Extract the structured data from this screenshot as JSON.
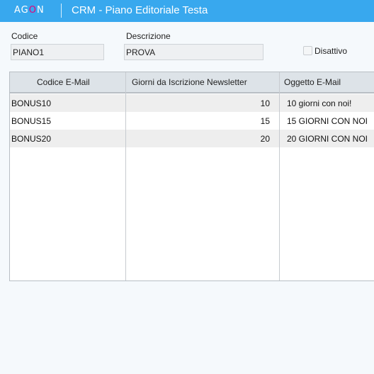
{
  "app": {
    "logo_prefix": "AG",
    "logo_o": "O",
    "logo_suffix": "N",
    "title": "CRM - Piano Editoriale Testa"
  },
  "form": {
    "codice_label": "Codice",
    "codice_value": "PIANO1",
    "descrizione_label": "Descrizione",
    "descrizione_value": "PROVA",
    "disattivo_label": "Disattivo",
    "disattivo_checked": false
  },
  "table": {
    "columns": [
      "Codice E-Mail",
      "Giorni da Iscrizione Newsletter",
      "Oggetto E-Mail"
    ],
    "rows": [
      {
        "codice": "BONUS10",
        "giorni": "10",
        "oggetto": "10 giorni con noi!"
      },
      {
        "codice": "BONUS15",
        "giorni": "15",
        "oggetto": "15 GIORNI CON NOI"
      },
      {
        "codice": "BONUS20",
        "giorni": "20",
        "oggetto": "20 GIORNI CON NOI"
      }
    ]
  },
  "colors": {
    "titlebar": "#38a8ee",
    "logo_accent": "#e4007a",
    "header_bg": "#dde3e8",
    "row_alt": "#eeeeee"
  }
}
